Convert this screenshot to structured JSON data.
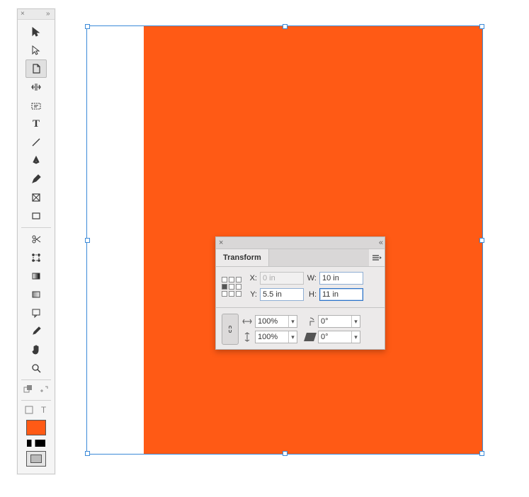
{
  "tools": {
    "selection": "selection-tool",
    "direct": "direct-selection-tool",
    "page": "page-tool",
    "gap": "gap-tool",
    "content": "content-grabber-tool",
    "type": "type-tool",
    "line": "line-tool",
    "pen": "pen-tool",
    "pencil": "pencil-tool",
    "frame": "rectangle-frame-tool",
    "rect": "rectangle-tool",
    "scissors": "scissors-tool",
    "freetransform": "free-transform-tool",
    "gradientswatch": "gradient-swatch-tool",
    "gradientfeather": "gradient-feather-tool",
    "note": "note-tool",
    "eyedropper": "eyedropper-tool",
    "hand": "hand-tool",
    "zoom": "zoom-tool"
  },
  "transform": {
    "title": "Transform",
    "x_label": "X:",
    "y_label": "Y:",
    "w_label": "W:",
    "h_label": "H:",
    "x_value": "0 in",
    "y_value": "5.5 in",
    "w_value": "10 in",
    "h_value": "11 in",
    "scale_x": "100%",
    "scale_y": "100%",
    "rotate": "0°",
    "shear": "0°"
  },
  "swatch": {
    "fill_color": "#ff5a15"
  },
  "canvas": {
    "artboard_color": "#ff5a15"
  }
}
